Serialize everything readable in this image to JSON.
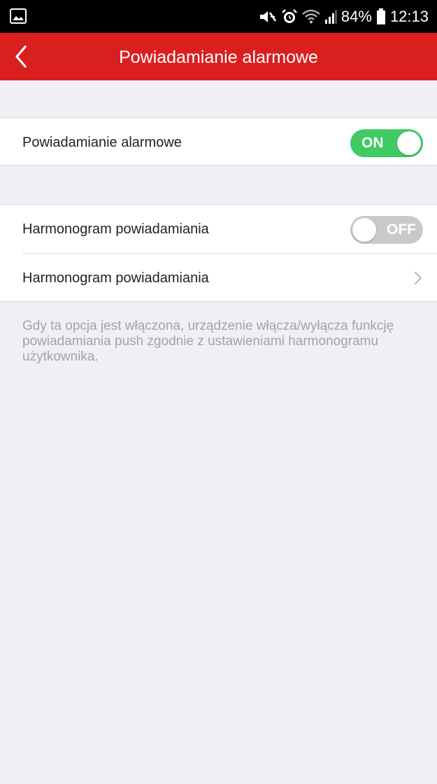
{
  "status_bar": {
    "battery": "84%",
    "time": "12:13",
    "left_icon": "image-icon",
    "right_icons": [
      "mute-icon",
      "alarm-icon",
      "wifi-icon",
      "signal-icon",
      "battery-icon"
    ]
  },
  "header": {
    "title": "Powiadamianie alarmowe",
    "back_icon": "back-chevron-icon",
    "background": "#da1f1f"
  },
  "settings": {
    "alarm_notification": {
      "label": "Powiadamianie alarmowe",
      "toggle_text": "ON",
      "state": true,
      "color": "#3fca64"
    },
    "schedule_toggle": {
      "label": "Harmonogram powiadamiania",
      "toggle_text": "OFF",
      "state": false,
      "color": "#c9c9c9"
    },
    "schedule_link": {
      "label": "Harmonogram powiadamiania",
      "icon": "chevron-right-icon"
    }
  },
  "hint_text": "Gdy ta opcja jest włączona, urządzenie włącza/wyłącza funkcję powiadamiania push zgodnie z ustawieniami harmonogramu użytkownika."
}
